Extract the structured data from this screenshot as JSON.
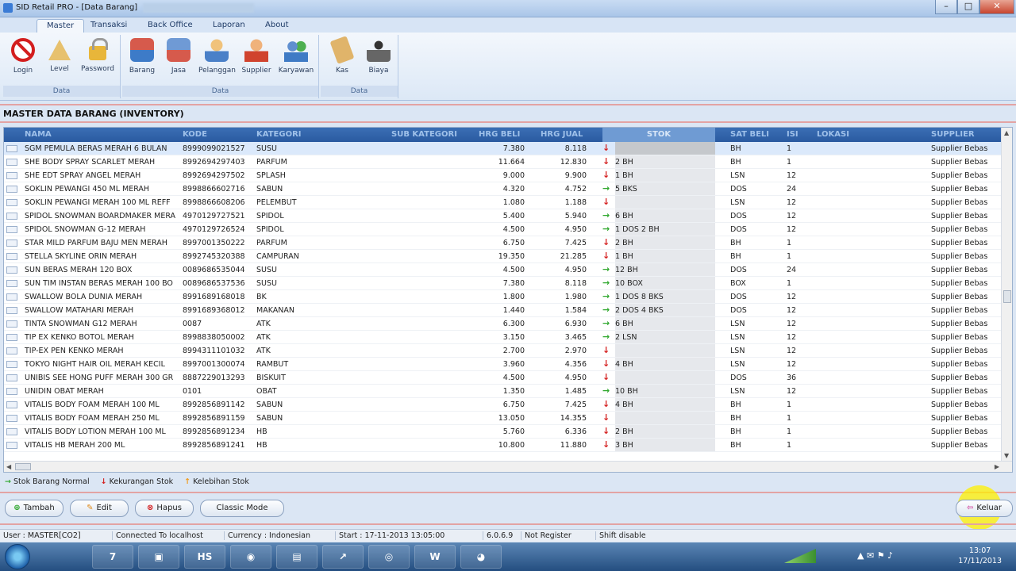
{
  "window": {
    "title": "SID Retail PRO - [Data Barang]",
    "buttons": {
      "minimize": "–",
      "maximize": "□",
      "close": "✕"
    }
  },
  "ribbon": {
    "tabs": [
      "Master",
      "Transaksi",
      "Back Office",
      "Laporan",
      "About"
    ],
    "groups": [
      {
        "label": "Data",
        "items": [
          "Login",
          "Level",
          "Password"
        ]
      },
      {
        "label": "Data",
        "items": [
          "Barang",
          "Jasa",
          "Pelanggan",
          "Supplier",
          "Karyawan"
        ]
      },
      {
        "label": "Data",
        "items": [
          "Kas",
          "Biaya"
        ]
      }
    ]
  },
  "section_title": "MASTER DATA BARANG (INVENTORY)",
  "grid": {
    "columns": [
      "NAMA",
      "KODE",
      "KATEGORI",
      "SUB KATEGORI",
      "HRG BELI",
      "HRG JUAL",
      "STOK",
      "SAT BELI",
      "ISI",
      "LOKASI",
      "SUPPLIER"
    ],
    "rows": [
      {
        "nama": "SGM PEMULA BERAS MERAH 6 BULAN",
        "kode": "8999099021527",
        "kategori": "SUSU",
        "beli": "7.380",
        "jual": "8.118",
        "status": "down",
        "stok": "",
        "sat": "BH",
        "isi": "1",
        "supplier": "Supplier Bebas"
      },
      {
        "nama": "SHE BODY SPRAY SCARLET MERAH",
        "kode": "8992694297403",
        "kategori": "PARFUM",
        "beli": "11.664",
        "jual": "12.830",
        "status": "down",
        "stok": "2 BH",
        "sat": "BH",
        "isi": "1",
        "supplier": "Supplier Bebas"
      },
      {
        "nama": "SHE EDT SPRAY ANGEL MERAH",
        "kode": "8992694297502",
        "kategori": "SPLASH",
        "beli": "9.000",
        "jual": "9.900",
        "status": "down",
        "stok": "1 BH",
        "sat": "LSN",
        "isi": "12",
        "supplier": "Supplier Bebas"
      },
      {
        "nama": "SOKLIN PEWANGI 450 ML MERAH",
        "kode": "8998866602716",
        "kategori": "SABUN",
        "beli": "4.320",
        "jual": "4.752",
        "status": "up",
        "stok": "5 BKS",
        "sat": "DOS",
        "isi": "24",
        "supplier": "Supplier Bebas"
      },
      {
        "nama": "SOKLIN PEWANGI MERAH 100 ML REFF",
        "kode": "8998866608206",
        "kategori": "PELEMBUT",
        "beli": "1.080",
        "jual": "1.188",
        "status": "down",
        "stok": "",
        "sat": "LSN",
        "isi": "12",
        "supplier": "Supplier Bebas"
      },
      {
        "nama": "SPIDOL SNOWMAN BOARDMAKER MERA",
        "kode": "4970129727521",
        "kategori": "SPIDOL",
        "beli": "5.400",
        "jual": "5.940",
        "status": "up",
        "stok": "6 BH",
        "sat": "DOS",
        "isi": "12",
        "supplier": "Supplier Bebas"
      },
      {
        "nama": "SPIDOL SNOWMAN G-12 MERAH",
        "kode": "4970129726524",
        "kategori": "SPIDOL",
        "beli": "4.500",
        "jual": "4.950",
        "status": "up",
        "stok": "1 DOS 2 BH",
        "sat": "DOS",
        "isi": "12",
        "supplier": "Supplier Bebas"
      },
      {
        "nama": "STAR MILD PARFUM BAJU MEN MERAH",
        "kode": "8997001350222",
        "kategori": "PARFUM",
        "beli": "6.750",
        "jual": "7.425",
        "status": "down",
        "stok": "2 BH",
        "sat": "BH",
        "isi": "1",
        "supplier": "Supplier Bebas"
      },
      {
        "nama": "STELLA SKYLINE ORIN MERAH",
        "kode": "8992745320388",
        "kategori": "CAMPURAN",
        "beli": "19.350",
        "jual": "21.285",
        "status": "down",
        "stok": "1 BH",
        "sat": "BH",
        "isi": "1",
        "supplier": "Supplier Bebas"
      },
      {
        "nama": "SUN BERAS MERAH 120 BOX",
        "kode": "0089686535044",
        "kategori": "SUSU",
        "beli": "4.500",
        "jual": "4.950",
        "status": "up",
        "stok": "12 BH",
        "sat": "DOS",
        "isi": "24",
        "supplier": "Supplier Bebas"
      },
      {
        "nama": "SUN TIM INSTAN BERAS MERAH 100 BO",
        "kode": "0089686537536",
        "kategori": "SUSU",
        "beli": "7.380",
        "jual": "8.118",
        "status": "up",
        "stok": "10 BOX",
        "sat": "BOX",
        "isi": "1",
        "supplier": "Supplier Bebas"
      },
      {
        "nama": "SWALLOW BOLA DUNIA MERAH",
        "kode": "8991689168018",
        "kategori": "BK",
        "beli": "1.800",
        "jual": "1.980",
        "status": "up",
        "stok": "1 DOS 8 BKS",
        "sat": "DOS",
        "isi": "12",
        "supplier": "Supplier Bebas"
      },
      {
        "nama": "SWALLOW MATAHARI MERAH",
        "kode": "8991689368012",
        "kategori": "MAKANAN",
        "beli": "1.440",
        "jual": "1.584",
        "status": "up",
        "stok": "2 DOS 4 BKS",
        "sat": "DOS",
        "isi": "12",
        "supplier": "Supplier Bebas"
      },
      {
        "nama": "TINTA SNOWMAN G12 MERAH",
        "kode": "0087",
        "kategori": "ATK",
        "beli": "6.300",
        "jual": "6.930",
        "status": "up",
        "stok": "6 BH",
        "sat": "LSN",
        "isi": "12",
        "supplier": "Supplier Bebas"
      },
      {
        "nama": "TIP EX KENKO BOTOL MERAH",
        "kode": "8998838050002",
        "kategori": "ATK",
        "beli": "3.150",
        "jual": "3.465",
        "status": "up",
        "stok": "2 LSN",
        "sat": "LSN",
        "isi": "12",
        "supplier": "Supplier Bebas"
      },
      {
        "nama": "TIP-EX PEN KENKO MERAH",
        "kode": "8994311101032",
        "kategori": "ATK",
        "beli": "2.700",
        "jual": "2.970",
        "status": "down",
        "stok": "",
        "sat": "LSN",
        "isi": "12",
        "supplier": "Supplier Bebas"
      },
      {
        "nama": "TOKYO NIGHT HAIR OIL MERAH KECIL",
        "kode": "8997001300074",
        "kategori": "RAMBUT",
        "beli": "3.960",
        "jual": "4.356",
        "status": "down",
        "stok": "4 BH",
        "sat": "LSN",
        "isi": "12",
        "supplier": "Supplier Bebas"
      },
      {
        "nama": "UNIBIS SEE HONG PUFF MERAH 300 GR",
        "kode": "8887229013293",
        "kategori": "BISKUIT",
        "beli": "4.500",
        "jual": "4.950",
        "status": "down",
        "stok": "",
        "sat": "DOS",
        "isi": "36",
        "supplier": "Supplier Bebas"
      },
      {
        "nama": "UNIDIN OBAT MERAH",
        "kode": "0101",
        "kategori": "OBAT",
        "beli": "1.350",
        "jual": "1.485",
        "status": "up",
        "stok": "10 BH",
        "sat": "LSN",
        "isi": "12",
        "supplier": "Supplier Bebas"
      },
      {
        "nama": "VITALIS BODY FOAM MERAH 100 ML",
        "kode": "8992856891142",
        "kategori": "SABUN",
        "beli": "6.750",
        "jual": "7.425",
        "status": "down",
        "stok": "4 BH",
        "sat": "BH",
        "isi": "1",
        "supplier": "Supplier Bebas"
      },
      {
        "nama": "VITALIS BODY FOAM MERAH 250 ML",
        "kode": "8992856891159",
        "kategori": "SABUN",
        "beli": "13.050",
        "jual": "14.355",
        "status": "down",
        "stok": "",
        "sat": "BH",
        "isi": "1",
        "supplier": "Supplier Bebas"
      },
      {
        "nama": "VITALIS BODY LOTION MERAH 100 ML",
        "kode": "8992856891234",
        "kategori": "HB",
        "beli": "5.760",
        "jual": "6.336",
        "status": "down",
        "stok": "2 BH",
        "sat": "BH",
        "isi": "1",
        "supplier": "Supplier Bebas"
      },
      {
        "nama": "VITALIS HB MERAH 200 ML",
        "kode": "8992856891241",
        "kategori": "HB",
        "beli": "10.800",
        "jual": "11.880",
        "status": "down",
        "stok": "3 BH",
        "sat": "BH",
        "isi": "1",
        "supplier": "Supplier Bebas"
      }
    ]
  },
  "legend": [
    "Stok Barang Normal",
    "Kekurangan Stok",
    "Kelebihan Stok"
  ],
  "buttons": {
    "tambah": "Tambah",
    "edit": "Edit",
    "hapus": "Hapus",
    "classic": "Classic Mode",
    "keluar": "Keluar"
  },
  "status": {
    "user": "User : MASTER[CO2]",
    "connection": "Connected To localhost",
    "currency": "Currency : Indonesian",
    "start": "Start : 17-11-2013 13:05:00",
    "version": "6.0.6.9",
    "register": "Not Register",
    "shift": "Shift disable"
  },
  "taskbar": {
    "time": "13:07",
    "date": "17/11/2013",
    "items": [
      "7",
      "▣",
      "HS",
      "◉",
      "▤",
      "↗",
      "◎",
      "W",
      "◕"
    ]
  },
  "colors": {
    "header_bg": "#2a5aa0",
    "accent_red": "#d41f1f",
    "accent_green": "#31a82f"
  }
}
